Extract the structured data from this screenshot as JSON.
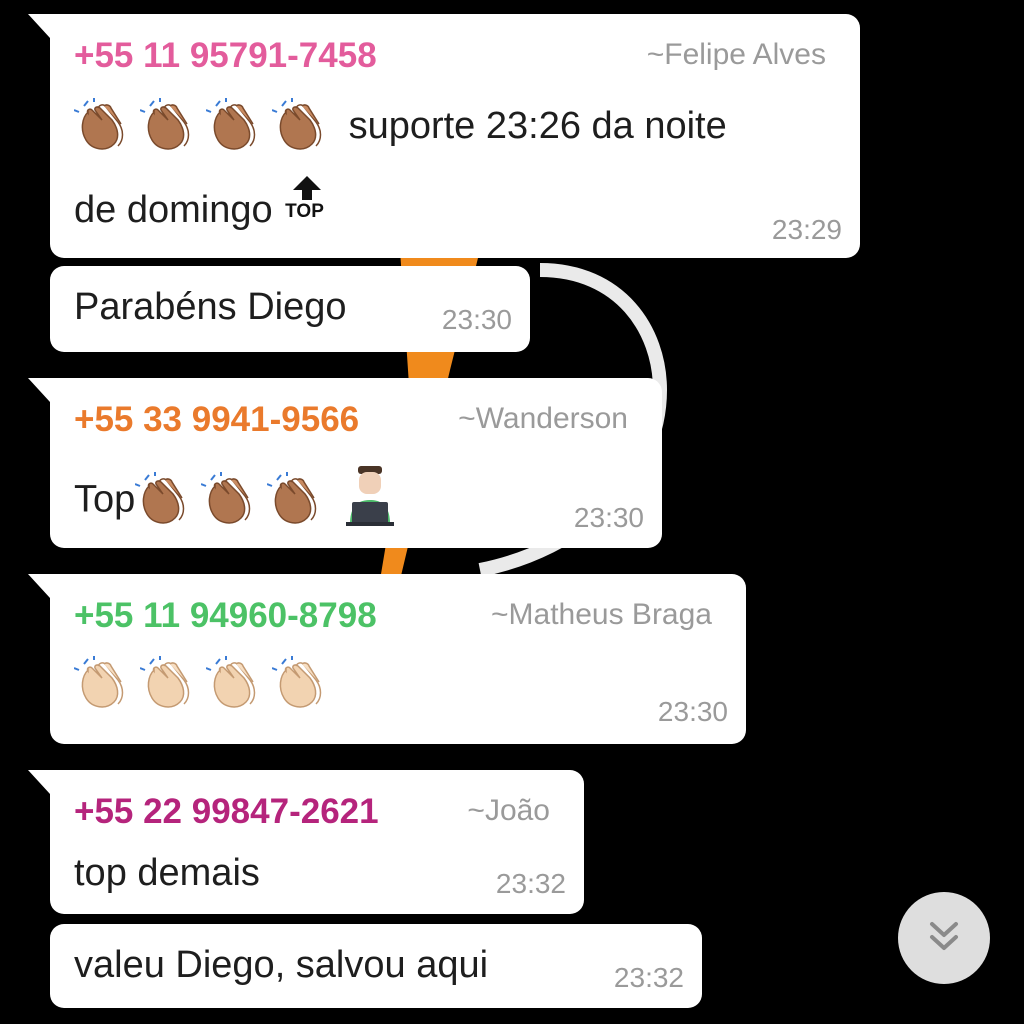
{
  "messages": [
    {
      "phone": "+55 11 95791-7458",
      "name": "~Felipe Alves",
      "phone_color": "#e35c9c",
      "line1": "suporte 23:26 da noite",
      "line2": "de domingo",
      "top_label": "TOP",
      "time": "23:29"
    },
    {
      "text": "Parabéns Diego",
      "time": "23:30"
    },
    {
      "phone": "+55 33 9941-9566",
      "name": "~Wanderson",
      "phone_color": "#ea7a2c",
      "text": "Top",
      "time": "23:30"
    },
    {
      "phone": "+55 11 94960-8798",
      "name": "~Matheus Braga",
      "phone_color": "#4cc266",
      "time": "23:30"
    },
    {
      "phone": "+55 22 99847-2621",
      "name": "~João",
      "phone_color": "#b5247c",
      "text": "top demais",
      "time": "23:32"
    },
    {
      "text": "valeu Diego, salvou aqui",
      "time": "23:32"
    }
  ],
  "icons": {
    "clap": "clapping-hands-icon",
    "top": "top-arrow-icon",
    "laptop": "person-laptop-icon",
    "scroll": "chevron-double-down-icon"
  },
  "colors": {
    "background": "#000000",
    "bubble": "#ffffff",
    "clap_dark": "#b07650",
    "clap_light": "#f2d3b1"
  }
}
